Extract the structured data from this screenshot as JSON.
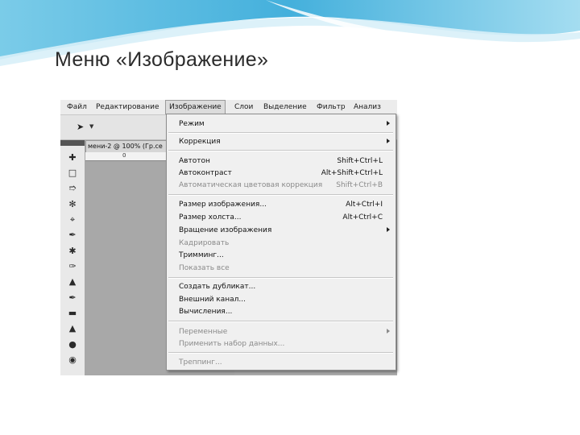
{
  "slide": {
    "title": "Меню «Изображение»"
  },
  "menubar": {
    "items": [
      "Файл",
      "Редактирование",
      "Изображение",
      "Слои",
      "Выделение",
      "Фильтр",
      "Анализ"
    ],
    "active_index": 2
  },
  "document": {
    "tab_label": "мени-2 @ 100% (Гр.се",
    "ruler_label": "0"
  },
  "menu": {
    "groups": [
      [
        {
          "label": "Режим",
          "submenu": true
        }
      ],
      [
        {
          "label": "Коррекция",
          "submenu": true
        }
      ],
      [
        {
          "label": "Автотон",
          "shortcut": "Shift+Ctrl+L"
        },
        {
          "label": "Автоконтраст",
          "shortcut": "Alt+Shift+Ctrl+L"
        },
        {
          "label": "Автоматическая цветовая коррекция",
          "shortcut": "Shift+Ctrl+B",
          "disabled": true
        }
      ],
      [
        {
          "label": "Размер изображения...",
          "shortcut": "Alt+Ctrl+I"
        },
        {
          "label": "Размер холста...",
          "shortcut": "Alt+Ctrl+C"
        },
        {
          "label": "Вращение изображения",
          "submenu": true
        },
        {
          "label": "Кадрировать",
          "disabled": true
        },
        {
          "label": "Тримминг..."
        },
        {
          "label": "Показать все",
          "disabled": true
        }
      ],
      [
        {
          "label": "Создать дубликат..."
        },
        {
          "label": "Внешний канал..."
        },
        {
          "label": "Вычисления..."
        }
      ],
      [
        {
          "label": "Переменные",
          "submenu": true,
          "disabled": true
        },
        {
          "label": "Применить набор данных...",
          "disabled": true
        }
      ],
      [
        {
          "label": "Треппинг...",
          "disabled": true
        }
      ]
    ]
  },
  "toolbox": {
    "tools": [
      "move-icon",
      "marquee-icon",
      "lasso-icon",
      "quick-select-icon",
      "crop-icon",
      "eyedropper-icon",
      "spot-heal-icon",
      "brush-icon",
      "stamp-icon",
      "history-brush-icon",
      "eraser-icon",
      "fill-icon",
      "blur-icon",
      "dodge-icon"
    ]
  },
  "colors": {
    "menu_bg": "#f0f0f0",
    "disabled_text": "#8a8a8a",
    "wave_blue": "#4fb3d9"
  }
}
